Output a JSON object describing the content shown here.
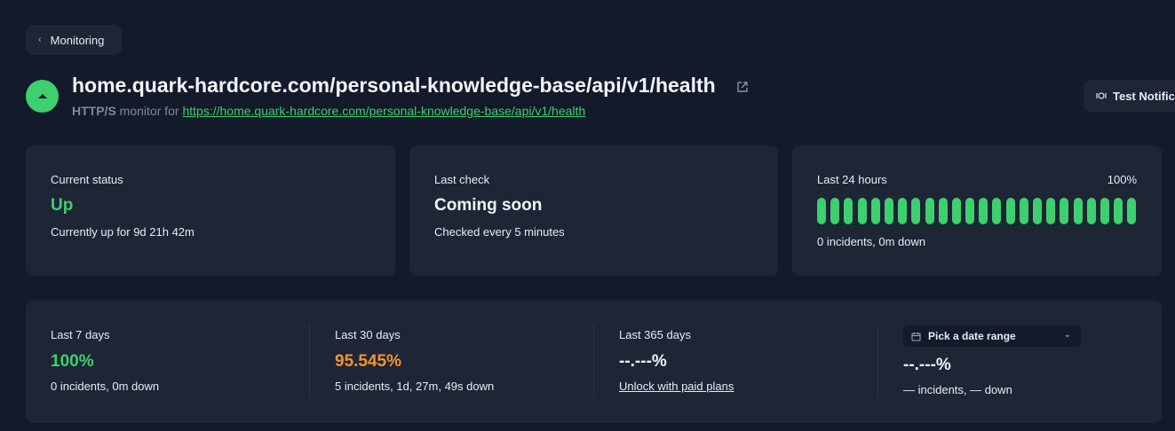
{
  "nav": {
    "back_label": "Monitoring"
  },
  "monitor": {
    "title": "home.quark-hardcore.com/personal-knowledge-base/api/v1/health",
    "protocol": "HTTP/S",
    "monitor_for": "monitor for",
    "url": "https://home.quark-hardcore.com/personal-knowledge-base/api/v1/health",
    "status_color": "#3ecf6e"
  },
  "actions": {
    "test_notification_label": "Test Notifica"
  },
  "current_status": {
    "label": "Current status",
    "value": "Up",
    "detail": "Currently up for 9d 21h 42m"
  },
  "last_check": {
    "label": "Last check",
    "value": "Coming soon",
    "detail": "Checked every 5 minutes"
  },
  "last_24h": {
    "label": "Last 24 hours",
    "percent": "100%",
    "detail": "0 incidents, 0m down",
    "bar_count": 24,
    "bar_color": "#3ecf6e"
  },
  "periods": [
    {
      "label": "Last 7 days",
      "value": "100%",
      "detail": "0 incidents, 0m down",
      "color": "#3ecf6e"
    },
    {
      "label": "Last 30 days",
      "value": "95.545%",
      "detail": "5 incidents, 1d, 27m, 49s down",
      "color": "#f5922e"
    },
    {
      "label": "Last 365 days",
      "value": "--.---%",
      "detail": "Unlock with paid plans",
      "color": "#f2f4f8"
    },
    {
      "label": "Pick a date range",
      "value": "--.---%",
      "detail": "— incidents, — down",
      "color": "#f2f4f8"
    }
  ]
}
